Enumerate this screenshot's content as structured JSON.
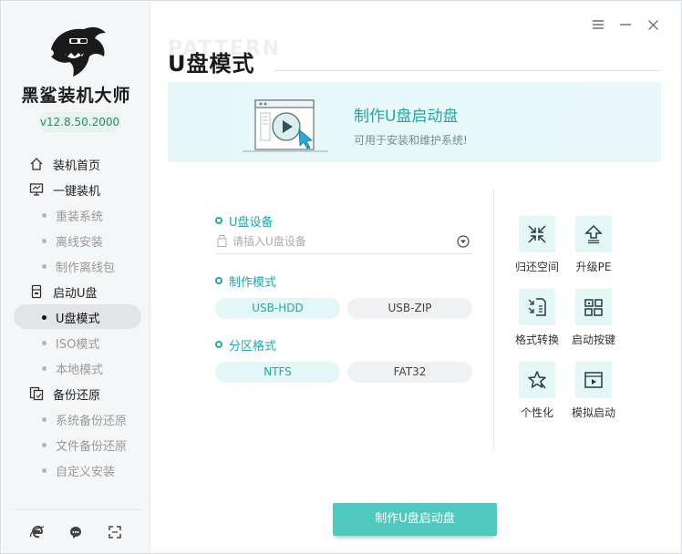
{
  "app": {
    "name": "黑鲨装机大师",
    "version": "v12.8.50.2000"
  },
  "sidebar": {
    "items": [
      {
        "label": "装机首页",
        "type": "main",
        "icon": "home-icon"
      },
      {
        "label": "一键装机",
        "type": "main",
        "icon": "monitor-icon"
      },
      {
        "label": "重装系统",
        "type": "sub"
      },
      {
        "label": "离线安装",
        "type": "sub"
      },
      {
        "label": "制作离线包",
        "type": "sub"
      },
      {
        "label": "启动U盘",
        "type": "main",
        "icon": "usb-drive-icon"
      },
      {
        "label": "U盘模式",
        "type": "sub",
        "active": true
      },
      {
        "label": "ISO模式",
        "type": "sub"
      },
      {
        "label": "本地模式",
        "type": "sub"
      },
      {
        "label": "备份还原",
        "type": "main",
        "icon": "backup-icon"
      },
      {
        "label": "系统备份还原",
        "type": "sub"
      },
      {
        "label": "文件备份还原",
        "type": "sub"
      },
      {
        "label": "自定义安装",
        "type": "sub"
      }
    ],
    "bottom_icons": [
      "browser-icon",
      "chat-support-icon",
      "fullscreen-icon"
    ]
  },
  "window_controls": [
    "menu-icon",
    "minimize-icon",
    "close-icon"
  ],
  "page": {
    "title": "U盘模式",
    "title_watermark": "PATTERN"
  },
  "banner": {
    "title": "制作U盘启动盘",
    "subtitle": "可用于安装和维护系统!"
  },
  "form": {
    "device": {
      "label": "U盘设备",
      "placeholder": "请插入U盘设备"
    },
    "mode": {
      "label": "制作模式",
      "options": [
        "USB-HDD",
        "USB-ZIP"
      ],
      "selected": "USB-HDD"
    },
    "partition": {
      "label": "分区格式",
      "options": [
        "NTFS",
        "FAT32"
      ],
      "selected": "NTFS"
    }
  },
  "tools": [
    {
      "label": "归还空间",
      "icon": "shrink-arrows-icon"
    },
    {
      "label": "升级PE",
      "icon": "upgrade-arrow-icon"
    },
    {
      "label": "格式转换",
      "icon": "file-convert-icon"
    },
    {
      "label": "启动按键",
      "icon": "keyboard-keys-icon"
    },
    {
      "label": "个性化",
      "icon": "personalize-star-icon"
    },
    {
      "label": "模拟启动",
      "icon": "simulate-window-icon"
    }
  ],
  "primary_button": "制作U盘启动盘",
  "colors": {
    "accent": "#1fa9a4",
    "button": "#4fc9bf",
    "banner_bg": "#e7f7f8",
    "sidebar_bg": "#f5f6f7"
  }
}
